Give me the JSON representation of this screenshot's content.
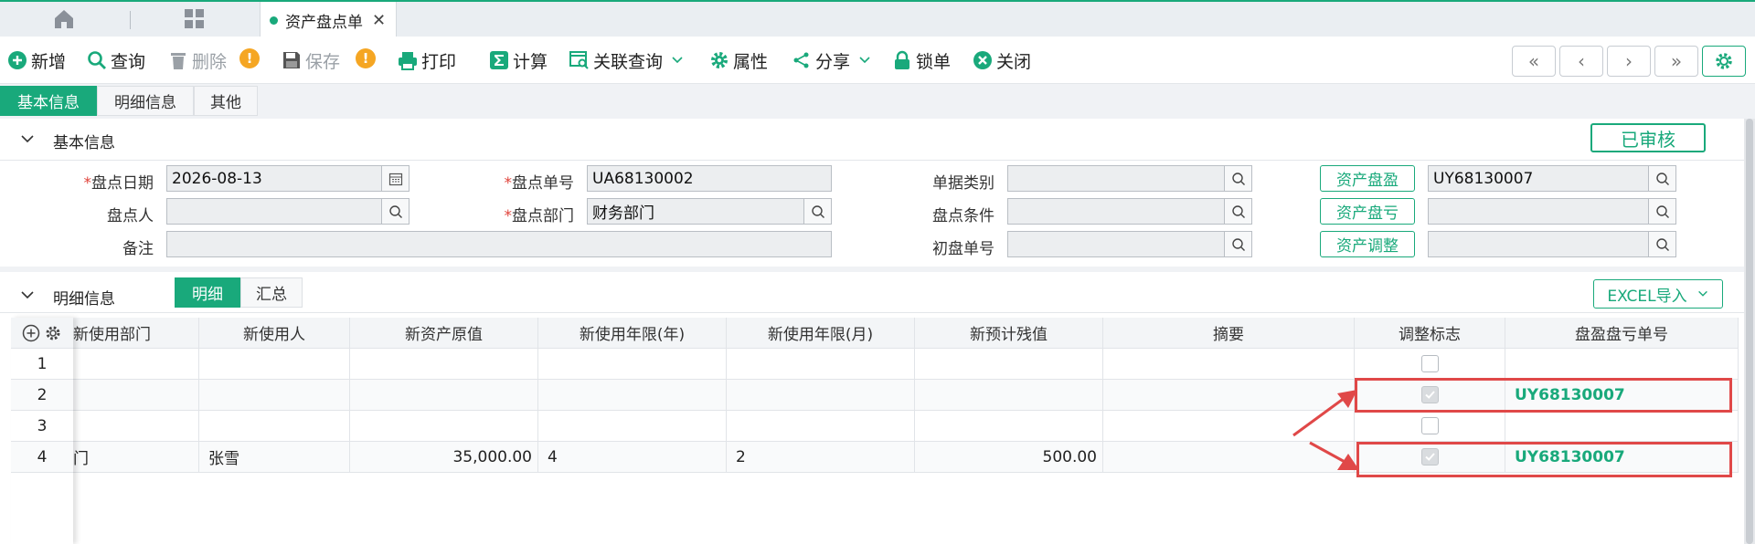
{
  "tabs": {
    "document_tab": "资产盘点单"
  },
  "toolbar": {
    "add": "新增",
    "query": "查询",
    "delete": "删除",
    "save": "保存",
    "print": "打印",
    "calc": "计算",
    "related_query": "关联查询",
    "properties": "属性",
    "share": "分享",
    "lock": "锁单",
    "close": "关闭"
  },
  "section_tabs": [
    "基本信息",
    "明细信息",
    "其他"
  ],
  "basic": {
    "title": "基本信息",
    "status": "已审核",
    "labels": {
      "date": "盘点日期",
      "number": "盘点单号",
      "category": "单据类别",
      "person": "盘点人",
      "dept": "盘点部门",
      "condition": "盘点条件",
      "remark": "备注",
      "initial_no": "初盘单号"
    },
    "values": {
      "date": "2026-08-13",
      "number": "UA68130002",
      "dept": "财务部门",
      "surplus_no": "UY68130007"
    },
    "buttons": {
      "surplus": "资产盘盈",
      "loss": "资产盘亏",
      "adjust": "资产调整"
    },
    "required_mark": "*"
  },
  "detail": {
    "title": "明细信息",
    "segments": [
      "明细",
      "汇总"
    ],
    "excel_button": "EXCEL导入",
    "columns": [
      "新使用部门",
      "新使用人",
      "新资产原值",
      "新使用年限(年)",
      "新使用年限(月)",
      "新预计残值",
      "摘要",
      "调整标志",
      "盘盈盘亏单号"
    ],
    "rows": [
      {
        "num": "1",
        "dept": "",
        "user": "",
        "value": "",
        "years": "",
        "months": "",
        "residual": "",
        "summary": "",
        "flag": false,
        "order": ""
      },
      {
        "num": "2",
        "dept": "",
        "user": "",
        "value": "",
        "years": "",
        "months": "",
        "residual": "",
        "summary": "",
        "flag": true,
        "order": "UY68130007"
      },
      {
        "num": "3",
        "dept": "",
        "user": "",
        "value": "",
        "years": "",
        "months": "",
        "residual": "",
        "summary": "",
        "flag": false,
        "order": ""
      },
      {
        "num": "4",
        "dept": "门",
        "user": "张雪",
        "value": "35,000.00",
        "years": "4",
        "months": "2",
        "residual": "500.00",
        "summary": "",
        "flag": true,
        "order": "UY68130007"
      }
    ]
  },
  "colors": {
    "accent": "#19a97b",
    "highlight": "#e04848",
    "warning": "#f5a623"
  }
}
